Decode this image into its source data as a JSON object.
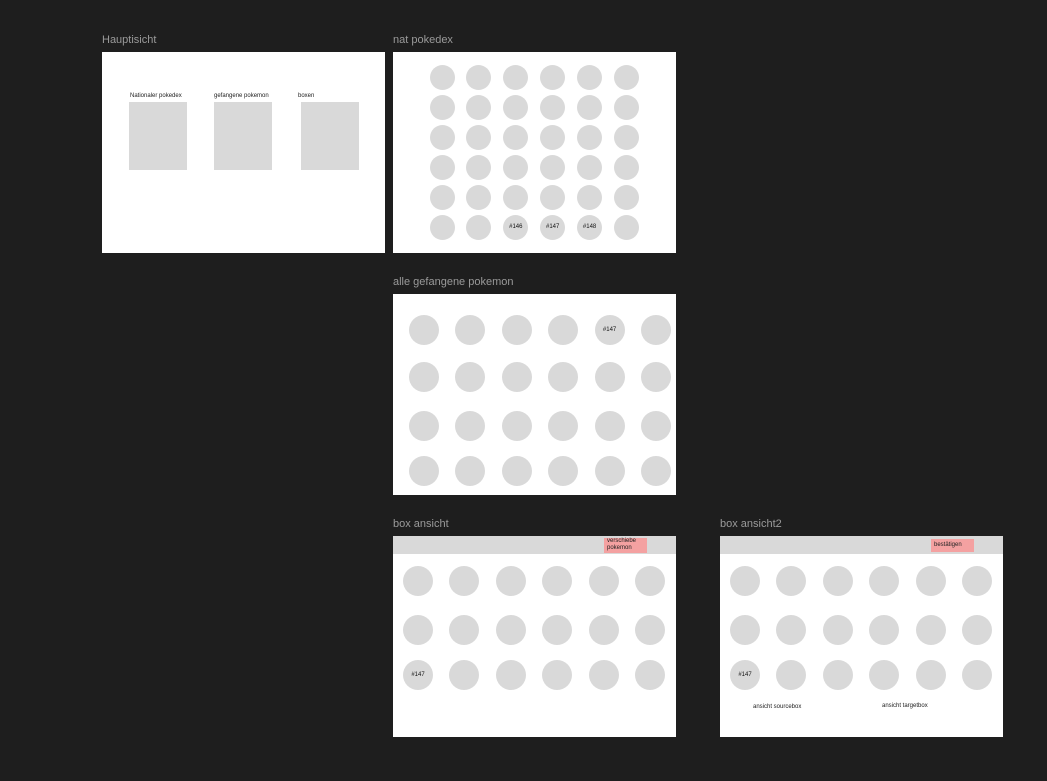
{
  "frames": {
    "hauptsicht": {
      "title": "Hauptisicht",
      "cards": [
        {
          "label": "Nationaler pokedex"
        },
        {
          "label": "gefangene pokemon"
        },
        {
          "label": "boxen"
        }
      ]
    },
    "nat_pokedex": {
      "title": "nat pokedex",
      "rows": 6,
      "cols": 6,
      "labels": {
        "30": "",
        "31": "",
        "32": "#146",
        "33": "#147",
        "34": "#148",
        "35": ""
      }
    },
    "gefangene": {
      "title": "alle gefangene pokemon",
      "rows": 4,
      "cols": 6,
      "labels": {
        "4": "#147"
      }
    },
    "box_ansicht": {
      "title": "box ansicht",
      "button_label_line1": "verschiebe",
      "button_label_line2": "pokemon",
      "rows": 3,
      "cols": 6,
      "labels": {
        "12": "#147"
      }
    },
    "box_ansicht2": {
      "title": "box ansicht2",
      "button_label": "bestätigen",
      "rows": 3,
      "cols": 6,
      "labels": {
        "12": "#147"
      },
      "note_source": "ansicht sourcebox",
      "note_target": "ansicht targetbox"
    }
  },
  "colors": {
    "canvas": "#1e1e1e",
    "frame": "#ffffff",
    "placeholder": "#d9d9d9",
    "accent_button": "#f4a1a1",
    "frame_title": "#9a9a9a"
  }
}
